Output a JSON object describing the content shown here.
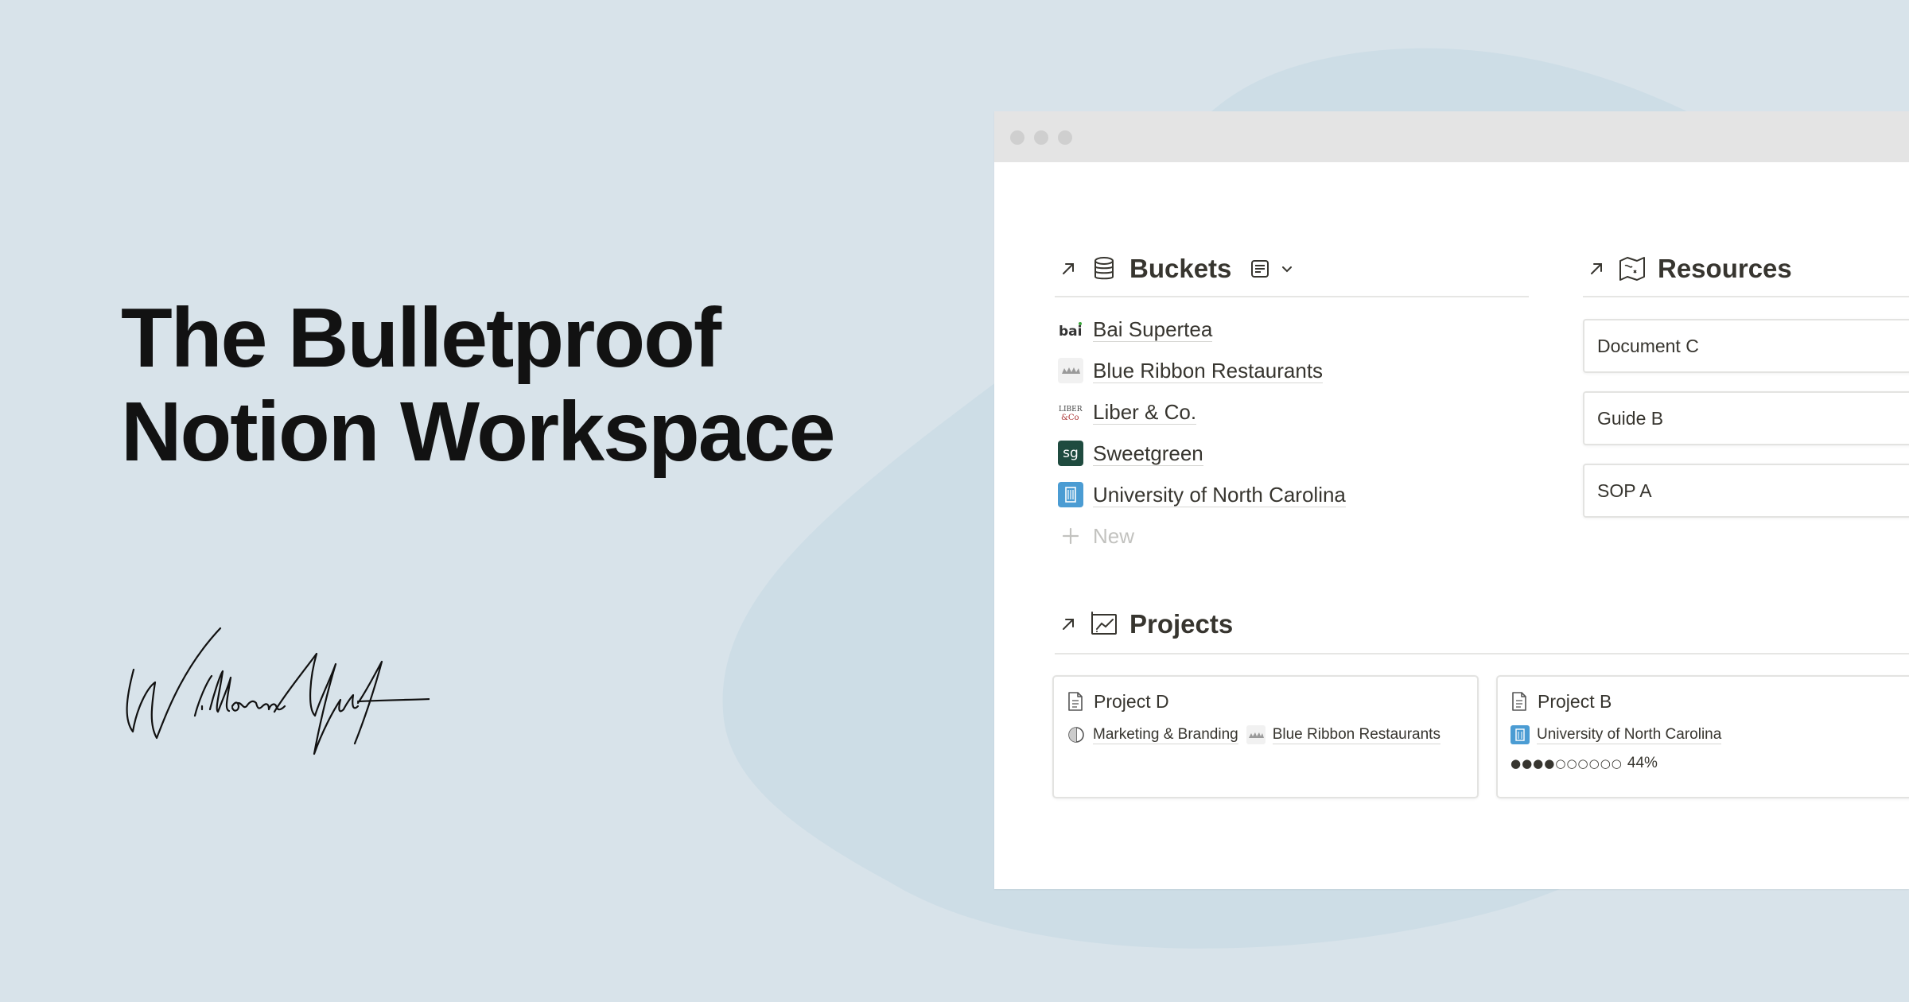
{
  "hero": {
    "title_line1": "The Bulletproof",
    "title_line2": "Notion Workspace",
    "signature": "William Nutt"
  },
  "colors": {
    "background": "#d8e3ea",
    "blob": "#cddde6",
    "sweetgreen": "#1f4b3f",
    "unc_blue": "#4b9cd3"
  },
  "window": {
    "buckets": {
      "title": "Buckets",
      "icon": "database-cylinder-icon",
      "items": [
        {
          "label": "Bai Supertea",
          "icon": "bai-logo"
        },
        {
          "label": "Blue Ribbon Restaurants",
          "icon": "blue-ribbon-logo"
        },
        {
          "label": "Liber & Co.",
          "icon": "liber-co-logo"
        },
        {
          "label": "Sweetgreen",
          "icon": "sweetgreen-logo",
          "icon_text": "sg"
        },
        {
          "label": "University of North Carolina",
          "icon": "unc-building-icon"
        }
      ],
      "new_label": "New"
    },
    "resources": {
      "title": "Resources",
      "icon": "map-icon",
      "cards": [
        "Document C",
        "Guide B",
        "SOP A"
      ]
    },
    "projects": {
      "title": "Projects",
      "icon": "chart-board-icon",
      "cards": [
        {
          "title": "Project D",
          "tags": [
            {
              "label": "Marketing & Branding",
              "icon": "half-circle-icon"
            },
            {
              "label": "Blue Ribbon Restaurants",
              "icon": "blue-ribbon-logo"
            }
          ]
        },
        {
          "title": "Project B",
          "tags": [
            {
              "label": "University of North Carolina",
              "icon": "unc-building-icon"
            }
          ],
          "progress": 0.44,
          "progress_dots": "●●●●○○○○○○",
          "progress_label": "44%"
        }
      ]
    }
  }
}
